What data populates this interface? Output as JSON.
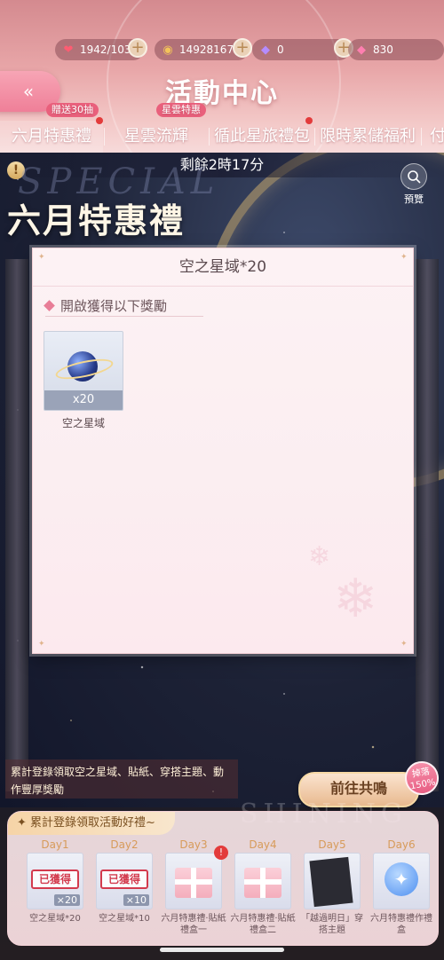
{
  "resources": [
    {
      "icon": "heart-icon",
      "value": "1942/103"
    },
    {
      "icon": "cat-coin-icon",
      "value": "14928167"
    },
    {
      "icon": "diamond-icon",
      "value": "0"
    },
    {
      "icon": "pink-diamond-icon",
      "value": "830"
    }
  ],
  "header": {
    "title": "活動中心",
    "back_label": "«"
  },
  "tabs": [
    {
      "label": "六月特惠禮",
      "badge": "贈送30抽",
      "active": true
    },
    {
      "label": "星雲流輝",
      "badge": "星雲特惠"
    },
    {
      "label": "循此星旅禮包"
    },
    {
      "label": "限時累儲福利"
    },
    {
      "label": "付"
    }
  ],
  "banner": {
    "countdown": "剩餘2時17分",
    "title": "六月特惠禮",
    "bg_text": "SPECIAL",
    "info_glyph": "!",
    "preview_label": "預覽"
  },
  "panel": {
    "title": "空之星域*20",
    "section_heading": "開啟獲得以下獎勵",
    "item": {
      "name": "空之星域",
      "count": "x20"
    }
  },
  "login": {
    "description": "累計登錄領取空之星域、貼紙、穿搭主題、動作豐厚獎勵",
    "go_button": "前往共鳴",
    "badge_line1": "掉落",
    "badge_line2": "150%",
    "watermark": "SHINING"
  },
  "daily": {
    "title": "累計登錄領取活動好禮~",
    "days": [
      {
        "day": "Day1",
        "name": "空之星域*20",
        "stamp": "已獲得",
        "count": "×20"
      },
      {
        "day": "Day2",
        "name": "空之星域*10",
        "stamp": "已獲得",
        "count": "×10"
      },
      {
        "day": "Day3",
        "name": "六月特惠禮·貼紙禮盒一"
      },
      {
        "day": "Day4",
        "name": "六月特惠禮·貼紙禮盒二"
      },
      {
        "day": "Day5",
        "name": "「越過明日」穿搭主題"
      },
      {
        "day": "Day6",
        "name": "六月特惠禮作禮盒"
      }
    ]
  },
  "colors": {
    "accent_pink": "#ef7f98",
    "header_pink": "#e8a6a8",
    "gold": "#e8b98f",
    "alert_red": "#e33b3b"
  }
}
